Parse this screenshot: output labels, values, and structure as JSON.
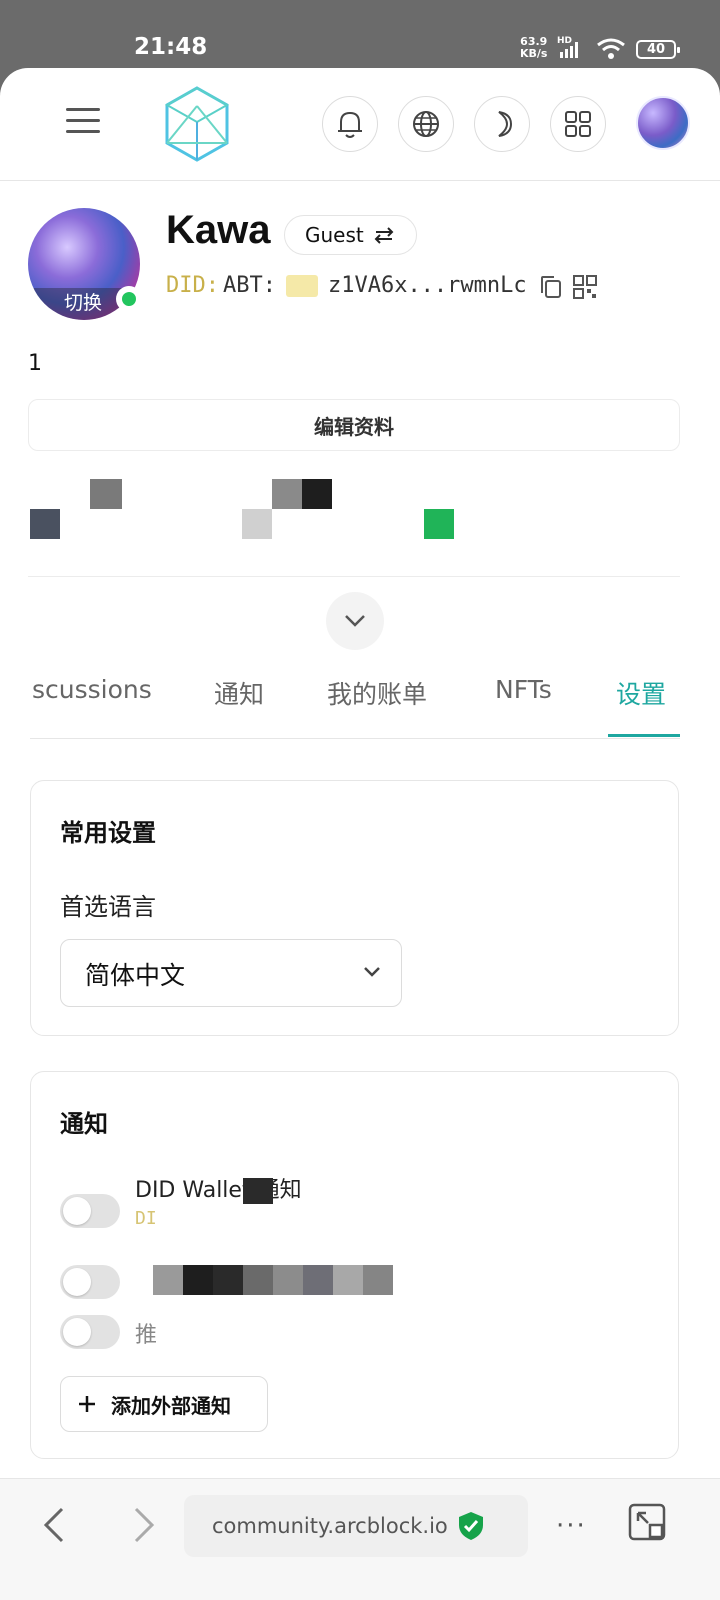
{
  "status_bar": {
    "time": "21:48",
    "net_speed_value": "63.9",
    "net_speed_unit": "KB/s",
    "hd": "HD",
    "battery": "40"
  },
  "header": {
    "menu_icon": "hamburger-menu-icon",
    "logo_icon": "arcblock-cube-logo-icon",
    "notification_icon": "bell-icon",
    "language_icon": "globe-icon",
    "theme_icon": "moon-icon",
    "apps_icon": "grid-apps-icon",
    "avatar_icon": "user-avatar"
  },
  "profile": {
    "name": "Kawa",
    "role_chip": "Guest",
    "role_switch_icon": "swap-arrows-icon",
    "switch_label": "切换",
    "did_prefix": "DID:",
    "did_chain": "ABT:",
    "did_short": "z1VA6x...rwmnLc",
    "bio": "1",
    "edit_button": "编辑资料"
  },
  "tabs": [
    {
      "label": "scussions",
      "active": false
    },
    {
      "label": "通知",
      "active": false
    },
    {
      "label": "我的账单",
      "active": false
    },
    {
      "label": "NFTs",
      "active": false
    },
    {
      "label": "设置",
      "active": true
    }
  ],
  "settings": {
    "general": {
      "title": "常用设置",
      "language_label": "首选语言",
      "language_value": "简体中文"
    },
    "notifications": {
      "title": "通知",
      "items": [
        {
          "label": "DID Wallet 通知",
          "sub": "DI",
          "enabled": false
        },
        {
          "label": "",
          "enabled": false
        },
        {
          "label": "推",
          "enabled": false
        }
      ],
      "add_button": "添加外部通知"
    }
  },
  "browser": {
    "url": "community.arcblock.io",
    "secure_icon": "shield-check-icon",
    "more": "···",
    "accent": "#1ea7a0"
  }
}
